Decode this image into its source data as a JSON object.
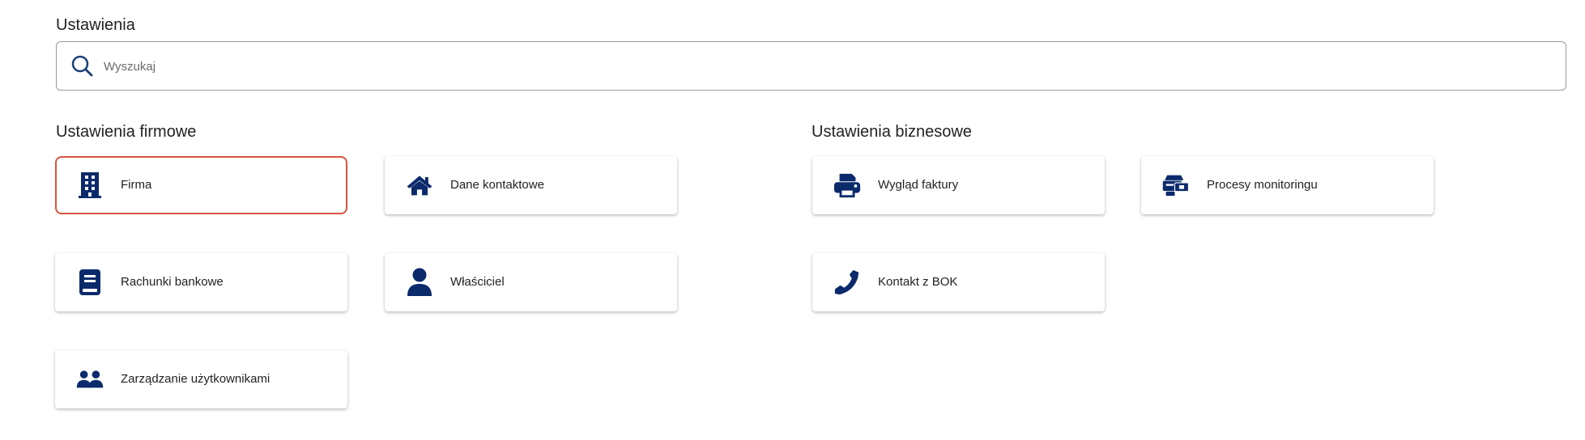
{
  "page": {
    "title": "Ustawienia"
  },
  "search": {
    "placeholder": "Wyszukaj",
    "icon": "search-icon"
  },
  "colors": {
    "icon": "#0b2a6b",
    "active_border": "#d9533f",
    "search_icon": "#1a3f7a"
  },
  "company_settings": {
    "title": "Ustawienia firmowe",
    "items": [
      {
        "label": "Firma",
        "icon": "building-icon",
        "active": true
      },
      {
        "label": "Dane kontaktowe",
        "icon": "home-icon",
        "active": false
      },
      {
        "label": "Rachunki bankowe",
        "icon": "book-icon",
        "active": false
      },
      {
        "label": "Właściciel",
        "icon": "user-icon",
        "active": false
      },
      {
        "label": "Zarządzanie użytkownikami",
        "icon": "users-icon",
        "active": false
      }
    ]
  },
  "business_settings": {
    "title": "Ustawienia biznesowe",
    "items": [
      {
        "label": "Wygląd faktury",
        "icon": "printer-icon",
        "active": false
      },
      {
        "label": "Procesy monitoringu",
        "icon": "monitoring-icon",
        "active": false
      },
      {
        "label": "Kontakt z BOK",
        "icon": "phone-icon",
        "active": false
      }
    ]
  }
}
